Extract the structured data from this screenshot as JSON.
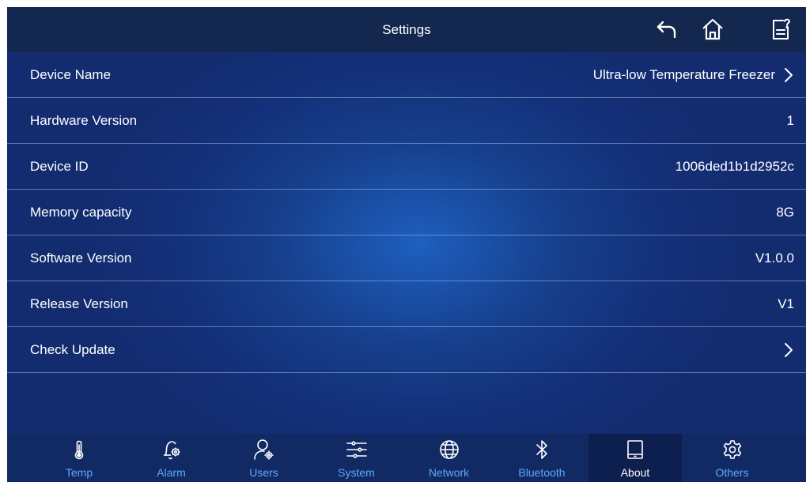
{
  "header": {
    "title": "Settings",
    "back_icon": "back-arrow-icon",
    "home_icon": "home-icon",
    "notes_icon": "notes-help-icon"
  },
  "rows": [
    {
      "label": "Device Name",
      "value": "Ultra-low Temperature Freezer",
      "chevron": true
    },
    {
      "label": "Hardware Version",
      "value": "1",
      "chevron": false
    },
    {
      "label": "Device ID",
      "value": "1006ded1b1d2952c",
      "chevron": false
    },
    {
      "label": "Memory capacity",
      "value": "8G",
      "chevron": false
    },
    {
      "label": "Software Version",
      "value": "V1.0.0",
      "chevron": false
    },
    {
      "label": "Release Version",
      "value": "V1",
      "chevron": false
    },
    {
      "label": "Check Update",
      "value": "",
      "chevron": true
    }
  ],
  "tabs": [
    {
      "label": "Temp",
      "icon": "thermometer-icon",
      "active": false
    },
    {
      "label": "Alarm",
      "icon": "alarm-bell-icon",
      "active": false
    },
    {
      "label": "Users",
      "icon": "user-settings-icon",
      "active": false
    },
    {
      "label": "System",
      "icon": "sliders-icon",
      "active": false
    },
    {
      "label": "Network",
      "icon": "globe-icon",
      "active": false
    },
    {
      "label": "Bluetooth",
      "icon": "bluetooth-icon",
      "active": false
    },
    {
      "label": "About",
      "icon": "tablet-icon",
      "active": true
    },
    {
      "label": "Others",
      "icon": "gear-icon",
      "active": false
    }
  ],
  "colors": {
    "header_bg": "#14274f",
    "tab_label": "#5ea8ff",
    "active_tab_bg": "#0d1f4e"
  }
}
